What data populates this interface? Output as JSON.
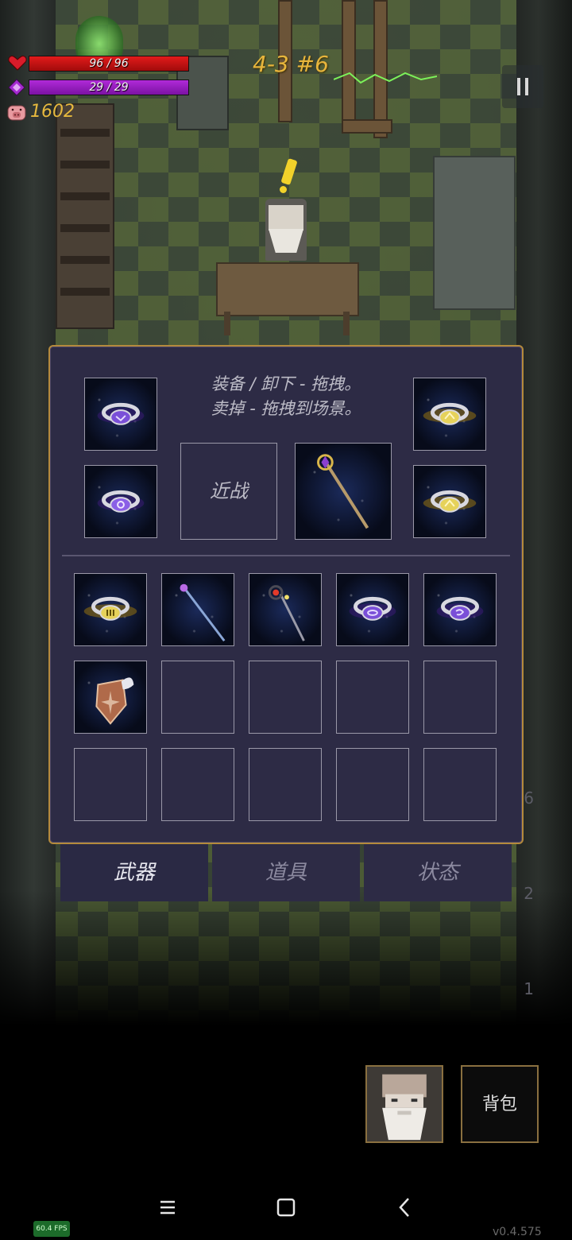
{
  "hud": {
    "hp_text": "96 / 96",
    "hp_fraction": 1.0,
    "mp_text": "29 / 29",
    "mp_fraction": 1.0,
    "gold": "1602",
    "level_label": "4-3 #6",
    "pause_icon": "pause-icon"
  },
  "panel": {
    "hint_line1": "装备 / 卸下 - 拖拽。",
    "hint_line2": "卖掉 - 拖拽到场景。",
    "melee_slot_label": "近战",
    "equipped": {
      "ring_top_left": "purple-ring-icon",
      "ring_bottom_left": "purple-flower-ring-icon",
      "ring_top_right": "yellow-shell-ring-icon",
      "ring_bottom_right": "yellow-shell-ring-icon",
      "weapon": "golden-staff-icon"
    },
    "inventory": [
      [
        "yellow-ring-icon",
        "blue-staff-icon",
        "dark-staff-icon",
        "purple-eye-ring-icon",
        "purple-sign-ring-icon"
      ],
      [
        "winged-shield-icon",
        "",
        "",
        "",
        ""
      ],
      [
        "",
        "",
        "",
        "",
        ""
      ]
    ]
  },
  "tabs": [
    {
      "label": "武器",
      "active": true
    },
    {
      "label": "道具",
      "active": false
    },
    {
      "label": "状态",
      "active": false
    }
  ],
  "side_counters": [
    "6",
    "2",
    "1"
  ],
  "bottom": {
    "avatar_icon": "wizard-portrait-icon",
    "bag_label": "背包"
  },
  "system": {
    "fps": "60.4 FPS",
    "version": "v0.4.575"
  },
  "colors": {
    "hp": "#e21b1b",
    "mp": "#b02ad8",
    "gold": "#e6b93e",
    "panel_bg": "#2d2b45",
    "panel_border": "#b48a3c"
  }
}
